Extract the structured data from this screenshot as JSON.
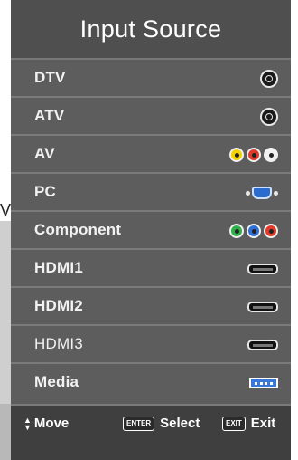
{
  "left_strip_char": "V",
  "title": "Input Source",
  "items": [
    {
      "label": "DTV",
      "icon": "coax-antenna-icon"
    },
    {
      "label": "ATV",
      "icon": "coax-antenna-icon"
    },
    {
      "label": "AV",
      "icon": "composite-rca-icon"
    },
    {
      "label": "PC",
      "icon": "vga-icon"
    },
    {
      "label": "Component",
      "icon": "component-rca-icon"
    },
    {
      "label": "HDMI1",
      "icon": "hdmi-icon"
    },
    {
      "label": "HDMI2",
      "icon": "hdmi-icon"
    },
    {
      "label": "HDMI3",
      "icon": "hdmi-icon"
    },
    {
      "label": "Media",
      "icon": "usb-icon"
    }
  ],
  "colors": {
    "av_rca": [
      "#f2d200",
      "#e03a2a",
      "#f2f2f2"
    ],
    "component_rca": [
      "#2fb04a",
      "#2f6fd8",
      "#e03a2a"
    ],
    "panel": "#5d5d5d",
    "header": "#4f4f4f",
    "footer": "#3f3f3f"
  },
  "footer": {
    "move_label": "Move",
    "enter_key": "ENTER",
    "select_label": "Select",
    "exit_key": "EXIT",
    "exit_label": "Exit"
  }
}
